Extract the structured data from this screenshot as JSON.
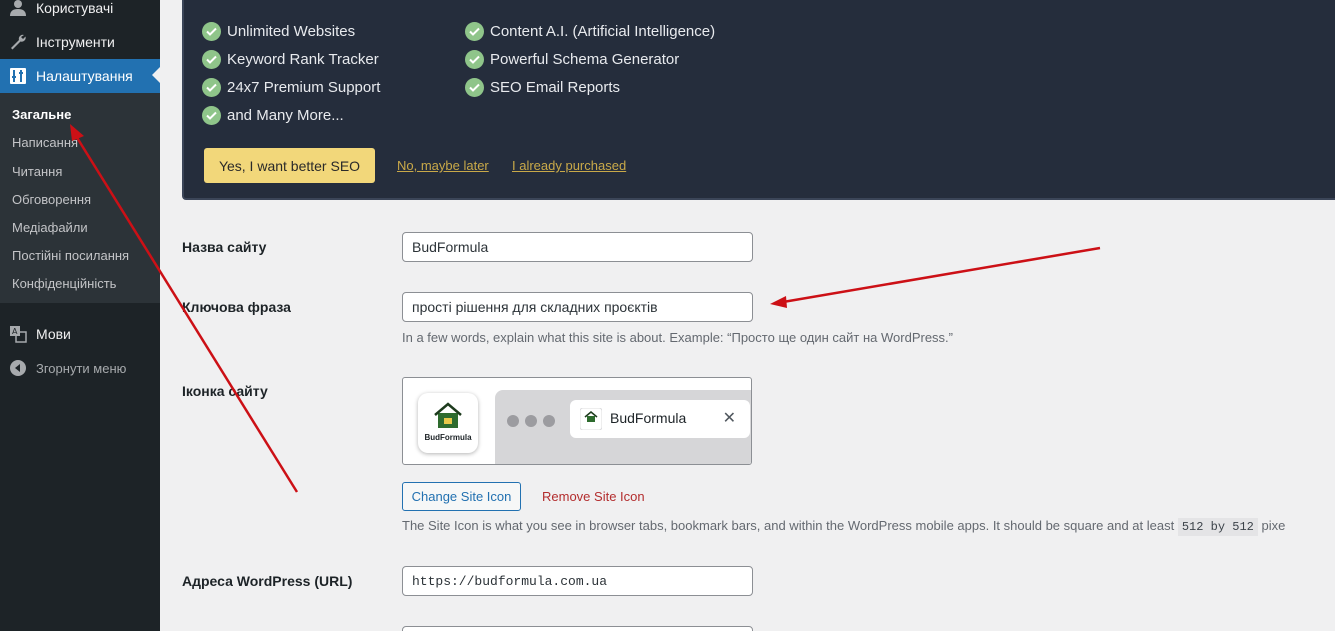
{
  "sidebar": {
    "menu": [
      {
        "label": "Користувачі",
        "icon": "users-icon"
      },
      {
        "label": "Інструменти",
        "icon": "wrench-icon"
      },
      {
        "label": "Налаштування",
        "icon": "settings-icon"
      }
    ],
    "submenu": [
      "Загальне",
      "Написання",
      "Читання",
      "Обговорення",
      "Медіафайли",
      "Постійні посилання",
      "Конфіденційність"
    ],
    "languages_label": "Мови",
    "collapse_label": "Згорнути меню"
  },
  "promo": {
    "features_left": [
      "Unlimited Websites",
      "Keyword Rank Tracker",
      "24x7 Premium Support",
      "and Many More..."
    ],
    "features_right": [
      "Content A.I. (Artificial Intelligence)",
      "Powerful Schema Generator",
      "SEO Email Reports"
    ],
    "cta": "Yes, I want better SEO",
    "decline": "No, maybe later",
    "purchased": "I already purchased"
  },
  "form": {
    "site_title_label": "Назва сайту",
    "site_title_value": "BudFormula",
    "tagline_label": "Ключова фраза",
    "tagline_value": "прості рішення для складних проєктів",
    "tagline_desc": "In a few words, explain what this site is about. Example: “Просто ще один сайт на WordPress.”",
    "site_icon_label": "Іконка сайту",
    "icon_brand": "BudFormula",
    "tab_title": "BudFormula",
    "change_icon": "Change Site Icon",
    "remove_icon": "Remove Site Icon",
    "icon_desc": "The Site Icon is what you see in browser tabs, bookmark bars, and within the WordPress mobile apps. It should be square and at least",
    "icon_size_code": "512 by 512",
    "icon_desc_tail": "pixe",
    "wp_url_label": "Адреса WordPress (URL)",
    "wp_url_value": "https://budformula.com.ua"
  },
  "colors": {
    "sidebar_bg": "#1d2327",
    "active_bg": "#2271b1",
    "promo_bg": "#252d3c",
    "cta_bg": "#f2d77a",
    "annotation": "#cc1016"
  }
}
